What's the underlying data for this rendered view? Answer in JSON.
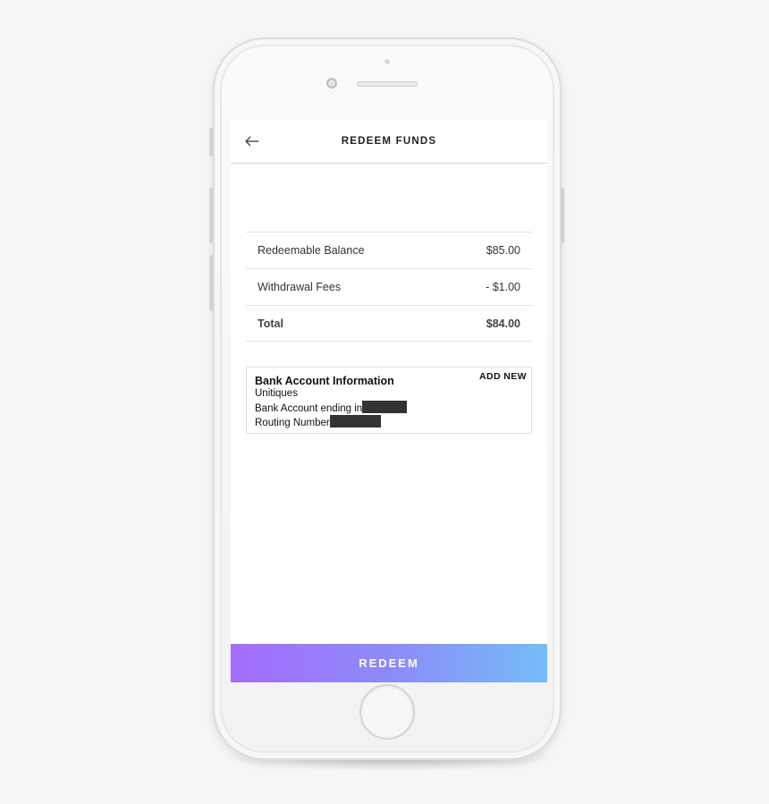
{
  "header": {
    "title": "REDEEM FUNDS",
    "back_icon": "arrow-left-icon"
  },
  "summary": {
    "rows": [
      {
        "label": "Redeemable Balance",
        "value": "$85.00"
      },
      {
        "label": "Withdrawal Fees",
        "value": "- $1.00"
      },
      {
        "label": "Total",
        "value": "$84.00"
      }
    ]
  },
  "bank": {
    "title": "Bank Account Information",
    "add_new_label": "ADD NEW",
    "bank_name": "Unitiques",
    "account_label": "Bank Account ending in",
    "routing_label": "Routing Number"
  },
  "footer": {
    "redeem_label": "REDEEM"
  },
  "colors": {
    "gradient_start": "#a46bfb",
    "gradient_end": "#74bdf6",
    "redaction": "#333333"
  }
}
